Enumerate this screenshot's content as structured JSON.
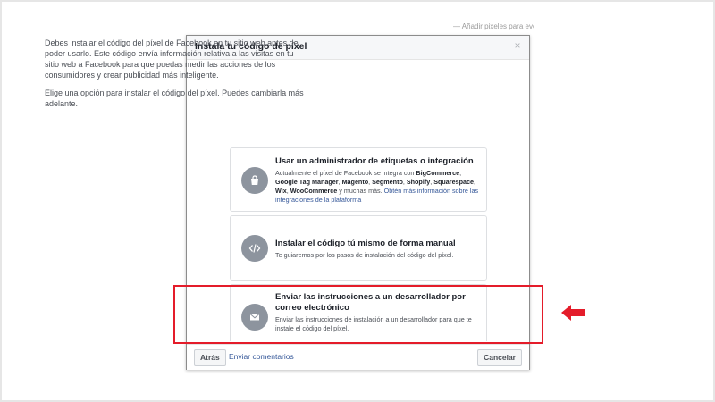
{
  "background": {
    "snippet": "— Añadir pixeles para eventos"
  },
  "dialog": {
    "title": "Instala tu código de píxel",
    "close_glyph": "×",
    "intro": "Debes instalar el código del píxel de Facebook en tu sitio web antes de poder usarlo. Este código envía información relativa a las visitas en tu sitio web a Facebook para que puedas medir las acciones de los consumidores y crear publicidad más inteligente.",
    "instruction": "Elige una opción para instalar el código del píxel. Puedes cambiarla más adelante.",
    "options": [
      {
        "icon": "shopping-bag-icon",
        "title": "Usar un administrador de etiquetas o integración",
        "desc_prefix": "Actualmente el píxel de Facebook se integra con ",
        "brands": [
          "BigCommerce",
          "Google Tag Manager",
          "Magento",
          "Segmento",
          "Shopify",
          "Squarespace",
          "Wix",
          "WooCommerce"
        ],
        "desc_suffix": " y muchas más. ",
        "link": "Obtén más información sobre las integraciones de la plataforma"
      },
      {
        "icon": "code-icon",
        "title": "Instalar el código tú mismo de forma manual",
        "desc": "Te guiaremos por los pasos de instalación del código del píxel."
      },
      {
        "icon": "envelope-icon",
        "title": "Enviar las instrucciones a un desarrollador por correo electrónico",
        "desc": "Enviar las instrucciones de instalación a un desarrollador para que te instale el código del píxel."
      }
    ],
    "footer": {
      "back_label": "Atrás",
      "feedback_link": "Enviar comentarios",
      "cancel_label": "Cancelar"
    }
  },
  "annotation": {
    "highlight_color": "#e41c2a"
  },
  "colors": {
    "icon_bg": "#8d949e",
    "link": "#365899"
  }
}
